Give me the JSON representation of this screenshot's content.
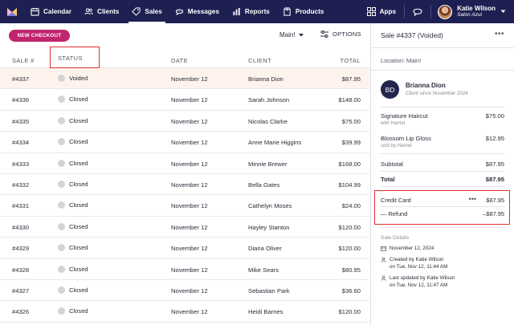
{
  "nav": {
    "items": [
      {
        "label": "Calendar",
        "icon": "calendar-icon"
      },
      {
        "label": "Clients",
        "icon": "clients-icon"
      },
      {
        "label": "Sales",
        "icon": "tag-icon",
        "active": true
      },
      {
        "label": "Messages",
        "icon": "chat-bubble-icon"
      },
      {
        "label": "Reports",
        "icon": "bar-chart-icon"
      },
      {
        "label": "Products",
        "icon": "box-icon"
      }
    ],
    "apps_label": "Apps",
    "user_name": "Katie Wilson",
    "user_salon": "Salon Azul"
  },
  "toolbar": {
    "new_checkout_label": "NEW CHECKOUT",
    "location_label": "Main!",
    "options_label": "OPTIONS"
  },
  "table": {
    "headers": {
      "sale": "SALE #",
      "status": "STATUS",
      "date": "DATE",
      "client": "CLIENT",
      "total": "TOTAL"
    },
    "rows": [
      {
        "sale": "#4337",
        "status": "Voided",
        "date": "November 12",
        "client": "Brianna Dion",
        "total": "$87.95"
      },
      {
        "sale": "#4336",
        "status": "Closed",
        "date": "November 12",
        "client": "Sarah Johnson",
        "total": "$148.00"
      },
      {
        "sale": "#4335",
        "status": "Closed",
        "date": "November 12",
        "client": "Nicolas Clarke",
        "total": "$75.00"
      },
      {
        "sale": "#4334",
        "status": "Closed",
        "date": "November 12",
        "client": "Anne Marie Higgins",
        "total": "$39.99"
      },
      {
        "sale": "#4333",
        "status": "Closed",
        "date": "November 12",
        "client": "Minnie Brewer",
        "total": "$168.00"
      },
      {
        "sale": "#4332",
        "status": "Closed",
        "date": "November 12",
        "client": "Bella Gates",
        "total": "$104.99"
      },
      {
        "sale": "#4331",
        "status": "Closed",
        "date": "November 12",
        "client": "Cathelyn Moses",
        "total": "$24.00"
      },
      {
        "sale": "#4330",
        "status": "Closed",
        "date": "November 12",
        "client": "Hayley Stanton",
        "total": "$120.00"
      },
      {
        "sale": "#4329",
        "status": "Closed",
        "date": "November 12",
        "client": "Diana Oliver",
        "total": "$120.00"
      },
      {
        "sale": "#4328",
        "status": "Closed",
        "date": "November 12",
        "client": "Mike Sears",
        "total": "$80.95"
      },
      {
        "sale": "#4327",
        "status": "Closed",
        "date": "November 12",
        "client": "Sebastian Park",
        "total": "$36.60"
      },
      {
        "sale": "#4326",
        "status": "Closed",
        "date": "November 12",
        "client": "Heidi Barnes",
        "total": "$120.00"
      }
    ]
  },
  "panel": {
    "title": "Sale #4337 (Voided)",
    "location": "Location:  Main!",
    "client_initials": "BD",
    "client_name": "Brianna Dion",
    "client_since": "Client since November 2024",
    "items": [
      {
        "name": "Signature Haircut",
        "sub": "with Harriet",
        "amount": "$75.00"
      },
      {
        "name": "Blossom Lip Gloss",
        "sub": "sold by Harriet",
        "amount": "$12.95"
      }
    ],
    "subtotal_label": "Subtotal",
    "subtotal": "$87.95",
    "total_label": "Total",
    "total": "$87.95",
    "payment_label": "Credit Card",
    "payment_amount": "$87.95",
    "refund_label": "— Refund",
    "refund_amount": "–$87.95",
    "details_title": "Sale Details",
    "detail_date": "November 12, 2024",
    "created_line1": "Created by Katie Wilson",
    "created_line2": "on Tue, Nov 12, 11:44 AM",
    "updated_line1": "Last updated by Katie Wilson",
    "updated_line2": "on Tue, Nov 12, 11:47 AM"
  },
  "colors": {
    "nav_bg": "#1f2052",
    "accent": "#c0256e",
    "highlight": "#e0322d",
    "selected_row": "#fdf3ec"
  }
}
